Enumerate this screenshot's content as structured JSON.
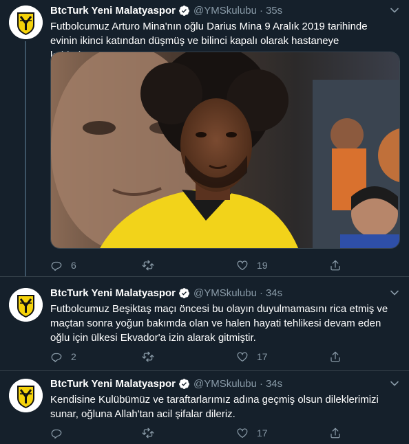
{
  "tweets": [
    {
      "author_name": "BtcTurk Yeni Malatyaspor",
      "handle": "@YMSkulubu",
      "separator": "·",
      "time": "35s",
      "text": "Futbolcumuz Arturo Mina'nın oğlu Darius Mina 9 Aralık 2019 tarihinde evinin ikinci katından düşmüş ve bilinci kapalı olarak hastaneye kaldırılmıştır.",
      "replies": "6",
      "retweets": "",
      "likes": "19"
    },
    {
      "author_name": "BtcTurk Yeni Malatyaspor",
      "handle": "@YMSkulubu",
      "separator": "·",
      "time": "34s",
      "text": "Futbolcumuz Beşiktaş maçı öncesi bu olayın duyulmamasını rica etmiş ve maçtan sonra yoğun bakımda olan ve halen hayati tehlikesi devam eden oğlu için ülkesi Ekvador'a izin alarak gitmiştir.",
      "replies": "2",
      "retweets": "",
      "likes": "17"
    },
    {
      "author_name": "BtcTurk Yeni Malatyaspor",
      "handle": "@YMSkulubu",
      "separator": "·",
      "time": "34s",
      "text": "Kendisine Kulübümüz ve taraftarlarımız adına geçmiş olsun dileklerimizi sunar, oğluna Allah'tan acil şifalar dileriz.",
      "replies": "",
      "retweets": "",
      "likes": "17"
    }
  ],
  "colors": {
    "background": "#15202b",
    "secondary_text": "#8899a6",
    "verified_blue": "#ffffff",
    "divider": "#38444d",
    "club_yellow": "#f5d20a",
    "club_black": "#111111"
  },
  "icons": {
    "verified": "verified-badge-icon",
    "chevron": "chevron-down-icon",
    "reply": "reply-icon",
    "retweet": "retweet-icon",
    "like": "heart-icon",
    "share": "share-icon",
    "avatar": "club-logo"
  }
}
